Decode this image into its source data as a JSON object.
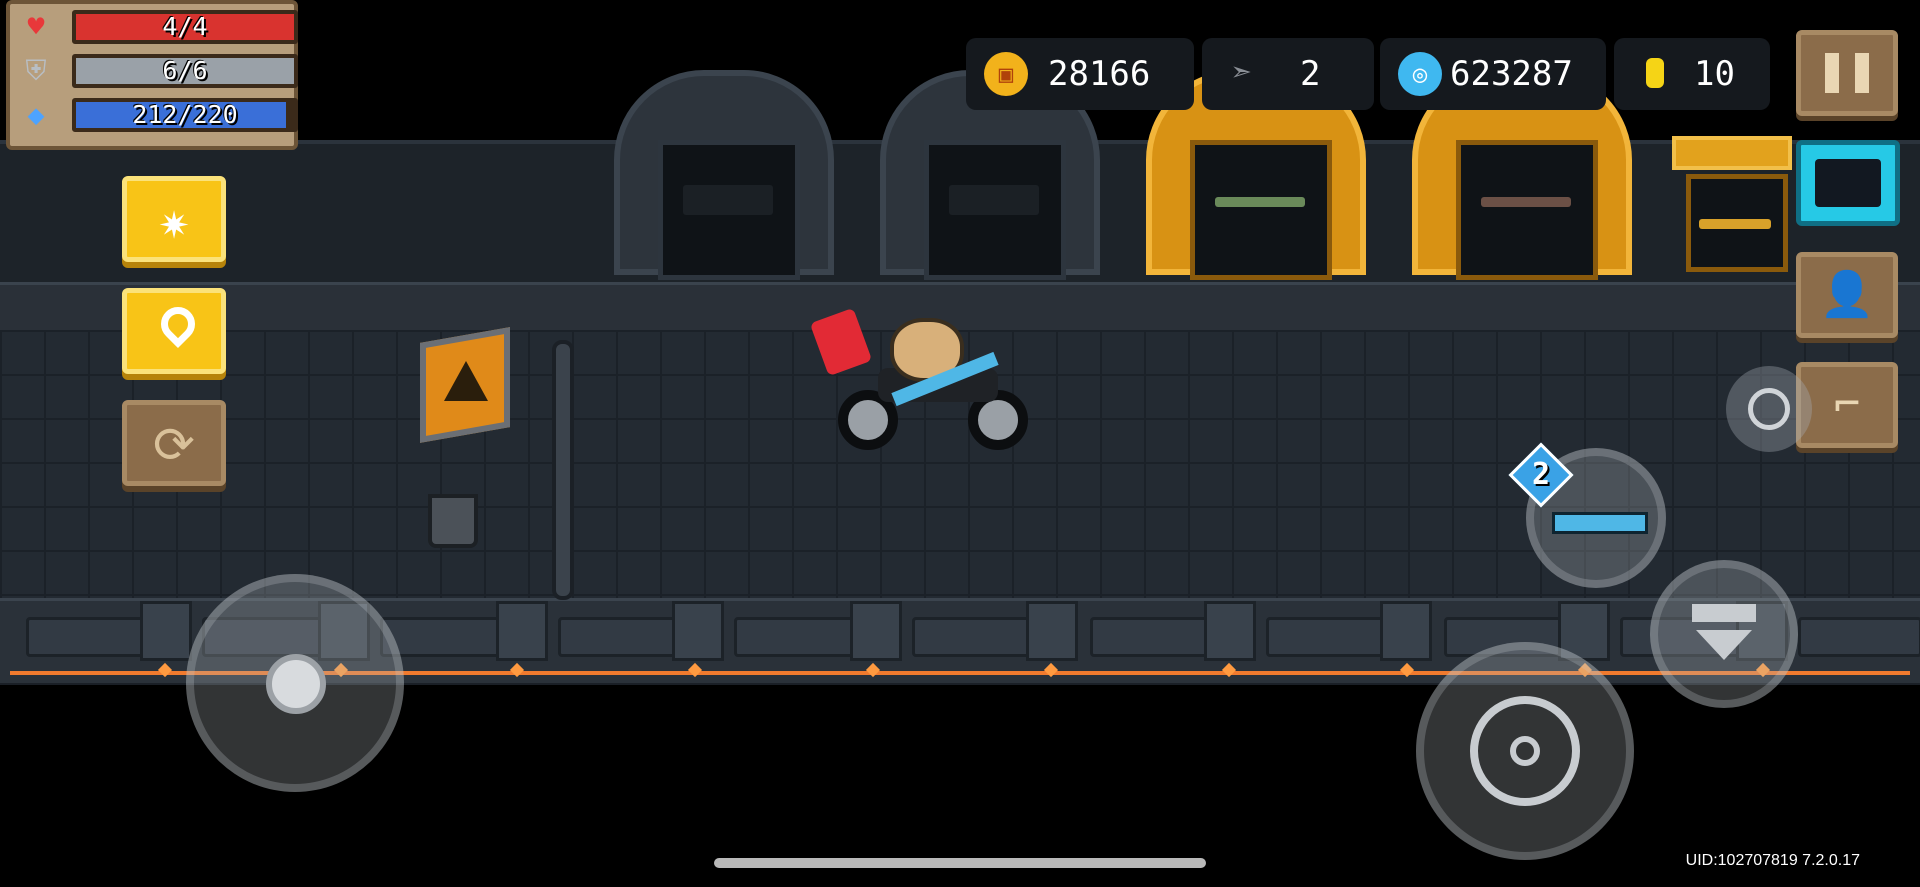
{
  "hud": {
    "health": {
      "icon": "heart-icon",
      "text": "4/4",
      "fill": 1.0,
      "color": "#d9332f"
    },
    "armor": {
      "icon": "shield-icon",
      "text": "6/6",
      "fill": 1.0,
      "color": "#9aa1a8"
    },
    "energy": {
      "icon": "diamond-icon",
      "text": "212/220",
      "fill": 0.9636,
      "color": "#3a6fd8"
    }
  },
  "currencies": [
    {
      "name": "coin",
      "icon": "coin-icon",
      "value": "28166",
      "color": "#f2b21b"
    },
    {
      "name": "fish",
      "icon": "fish-icon",
      "value": "2",
      "color": "#8a8f96"
    },
    {
      "name": "gems",
      "icon": "gem-icon",
      "value": "623287",
      "color": "#3fb8f0"
    },
    {
      "name": "gold",
      "icon": "gold-bar-icon",
      "value": "10",
      "color": "#f5d416"
    }
  ],
  "weapon": {
    "energy_cost": "2",
    "icon": "rifle-icon"
  },
  "footer": {
    "uid": "UID:102707819 7.2.0.17"
  },
  "icons": {
    "left_buttons": [
      "star-icon",
      "location-pin-icon",
      "switch-character-icon"
    ],
    "right_buttons": [
      "pause-icon",
      "chat-bot-icon",
      "profile-card-icon",
      "stairs-icon"
    ]
  }
}
